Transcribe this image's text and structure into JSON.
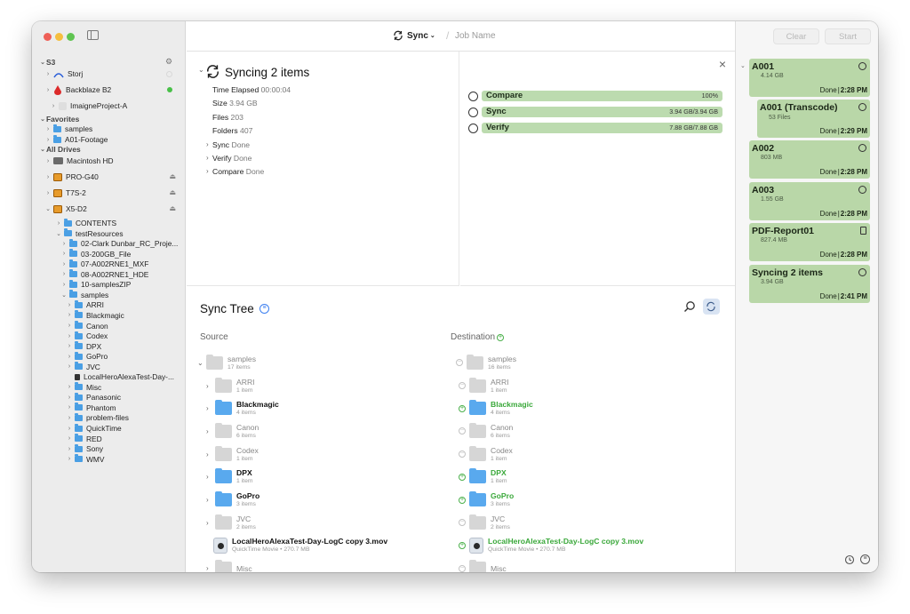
{
  "toolbar": {
    "sync_label": "Sync",
    "job_name_placeholder": "Job Name",
    "clear_label": "Clear",
    "start_label": "Start"
  },
  "sidebar": {
    "sections": {
      "s3": "S3",
      "favorites": "Favorites",
      "all_drives": "All Drives"
    },
    "storj": "Storj",
    "backblaze": "Backblaze B2",
    "imaigne": "ImaigneProject-A",
    "fav_samples": "samples",
    "fav_footage": "A01-Footage",
    "drives": [
      "Macintosh HD",
      "PRO-G40",
      "T7S-2",
      "X5-D2"
    ],
    "tree": [
      "CONTENTS",
      "testResources",
      "02-Clark Dunbar_RC_Proje...",
      "03-200GB_File",
      "07-A002RNE1_MXF",
      "08-A002RNE1_HDE",
      "10-samplesZIP",
      "samples",
      "ARRI",
      "Blackmagic",
      "Canon",
      "Codex",
      "DPX",
      "GoPro",
      "JVC",
      "LocalHeroAlexaTest-Day-...",
      "Misc",
      "Panasonic",
      "Phantom",
      "problem-files",
      "QuickTime",
      "RED",
      "Sony",
      "WMV"
    ]
  },
  "job": {
    "title": "Syncing 2 items",
    "details": [
      {
        "label": "Time Elapsed",
        "value": "00:00:04"
      },
      {
        "label": "Size",
        "value": "3.94 GB"
      },
      {
        "label": "Files",
        "value": "203"
      },
      {
        "label": "Folders",
        "value": "407"
      },
      {
        "label": "Sync",
        "value": "Done"
      },
      {
        "label": "Verify",
        "value": "Done"
      },
      {
        "label": "Compare",
        "value": "Done"
      }
    ],
    "progress": [
      {
        "label": "Compare",
        "value": "100%",
        "fraction": 1.0
      },
      {
        "label": "Sync",
        "value": "3.94 GB/3.94 GB",
        "fraction": 1.0
      },
      {
        "label": "Verify",
        "value": "7.88 GB/7.88 GB",
        "fraction": 1.0
      }
    ]
  },
  "sync_tree": {
    "title": "Sync Tree",
    "source_label": "Source",
    "dest_label": "Destination",
    "source_root": {
      "name": "samples",
      "sub": "17 items"
    },
    "dest_root": {
      "name": "samples",
      "sub": "16 items"
    },
    "items": [
      {
        "name": "ARRI",
        "sub": "1 item"
      },
      {
        "name": "Blackmagic",
        "sub": "4 items"
      },
      {
        "name": "Canon",
        "sub": "6 items"
      },
      {
        "name": "Codex",
        "sub": "1 item"
      },
      {
        "name": "DPX",
        "sub": "1 item"
      },
      {
        "name": "GoPro",
        "sub": "3 items"
      },
      {
        "name": "JVC",
        "sub": "2 items"
      },
      {
        "name": "LocalHeroAlexaTest-Day-LogC copy 3.mov",
        "sub": "QuickTime Movie • 270.7 MB"
      },
      {
        "name": "Misc",
        "sub": ""
      }
    ]
  },
  "jobs": [
    {
      "title": "A001",
      "sub": "4.14 GB",
      "status": "Done",
      "time": "2:28 PM"
    },
    {
      "title": "A001 (Transcode)",
      "sub": "53 Files",
      "status": "Done",
      "time": "2:29 PM"
    },
    {
      "title": "A002",
      "sub": "803 MB",
      "status": "Done",
      "time": "2:28 PM"
    },
    {
      "title": "A003",
      "sub": "1.55 GB",
      "status": "Done",
      "time": "2:28 PM"
    },
    {
      "title": "PDF-Report01",
      "sub": "827.4 MB",
      "status": "Done",
      "time": "2:28 PM"
    },
    {
      "title": "Syncing 2 items",
      "sub": "3.94 GB",
      "status": "Done",
      "time": "2:41 PM"
    }
  ],
  "colors": {
    "progress_fill": "#bcdbaf",
    "job_card": "#b9d7a8",
    "accent_blue": "#4a9fe4",
    "added_green": "#4ab04a"
  }
}
